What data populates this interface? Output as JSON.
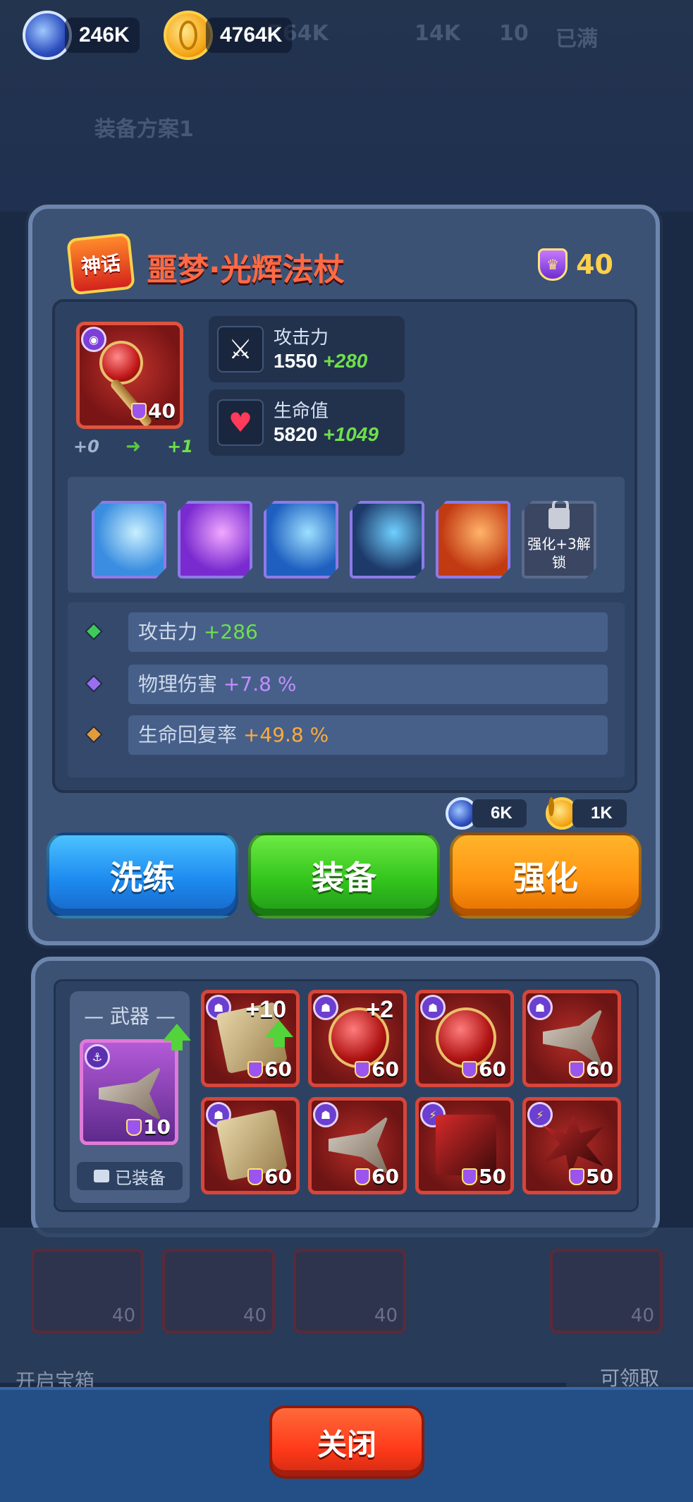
{
  "top_bar": {
    "gems": "246K",
    "gold": "4764K",
    "ghost_values": [
      "764K",
      "14K",
      "10",
      "已满"
    ],
    "ghost_loadout": "装备方案1"
  },
  "item": {
    "rarity_badge": "神话",
    "name": "噩梦·光辉法杖",
    "level": "40",
    "card_level": "40",
    "refine_from": "+0",
    "refine_to": "+1",
    "stats": [
      {
        "label": "攻击力",
        "base": "1550",
        "bonus": "+280",
        "icon": "sword-icon"
      },
      {
        "label": "生命值",
        "base": "5820",
        "bonus": "+1049",
        "icon": "heart-icon"
      }
    ],
    "skills": [
      {
        "icon": "ice-comet-skill-icon",
        "colors": [
          "#3a8de0",
          "#c8f0ff"
        ]
      },
      {
        "icon": "purple-burst-skill-icon",
        "colors": [
          "#7a2bd0",
          "#f0a8ff"
        ]
      },
      {
        "icon": "ice-shard-skill-icon",
        "colors": [
          "#1e5fc0",
          "#9ee0ff"
        ]
      },
      {
        "icon": "orb-swirl-skill-icon",
        "colors": [
          "#1d3a6a",
          "#6fd0ff"
        ]
      },
      {
        "icon": "fire-blast-skill-icon",
        "colors": [
          "#c23a12",
          "#ffb46a"
        ]
      }
    ],
    "locked_skill_text": "强化+3解锁",
    "affixes": [
      {
        "label": "攻击力",
        "value": "+286",
        "color": "#6ee04a",
        "gem_color": "#3fc95a"
      },
      {
        "label": "物理伤害",
        "value": "+7.8 %",
        "color": "#c48cff",
        "gem_color": "#9b6ef0"
      },
      {
        "label": "生命回复率",
        "value": "+49.8 %",
        "color": "#ffaa3a",
        "gem_color": "#e39a3a"
      }
    ]
  },
  "costs": {
    "gems": "6K",
    "gold": "1K"
  },
  "actions": {
    "refine": "洗练",
    "equip": "装备",
    "enhance": "强化"
  },
  "inventory": {
    "slot_title": "— 武器 —",
    "equipped_label": "已装备",
    "equipped_level": "10",
    "items": [
      {
        "art": "art-book",
        "level": "60",
        "plus": "+10",
        "badge": "demon",
        "upgrade": true
      },
      {
        "art": "art-staff",
        "level": "60",
        "plus": "+2",
        "badge": "demon",
        "upgrade": false
      },
      {
        "art": "art-staff",
        "level": "60",
        "plus": "",
        "badge": "demon",
        "upgrade": false
      },
      {
        "art": "art-cross",
        "level": "60",
        "plus": "",
        "badge": "demon",
        "upgrade": false
      },
      {
        "art": "art-book",
        "level": "60",
        "plus": "",
        "badge": "demon",
        "upgrade": false
      },
      {
        "art": "art-cross",
        "level": "60",
        "plus": "",
        "badge": "demon",
        "upgrade": false
      },
      {
        "art": "art-red",
        "level": "50",
        "plus": "",
        "badge": "bolt",
        "upgrade": false
      },
      {
        "art": "art-spike",
        "level": "50",
        "plus": "",
        "badge": "bolt",
        "upgrade": false
      }
    ]
  },
  "background": {
    "ghost_levels": [
      "40",
      "40",
      "40",
      "40"
    ],
    "chest_label": "开启宝箱",
    "claim_label": "可领取"
  },
  "footer": {
    "close": "关闭"
  }
}
